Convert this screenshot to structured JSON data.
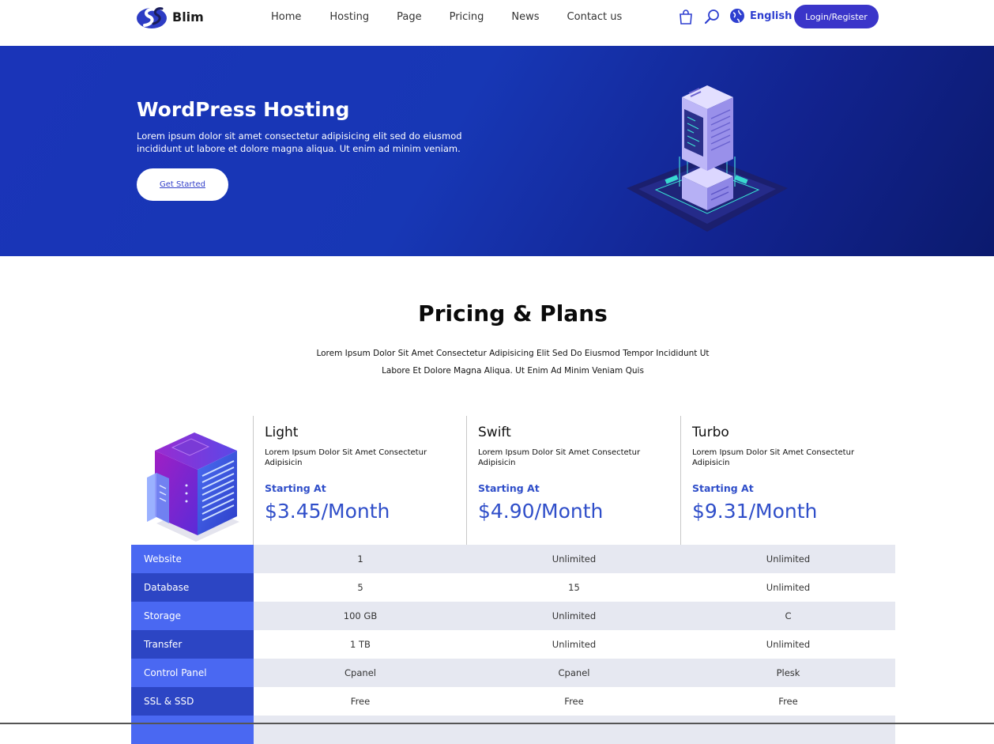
{
  "header": {
    "logo_text": "Blim",
    "nav": [
      "Home",
      "Hosting",
      "Page",
      "Pricing",
      "News",
      "Contact us"
    ],
    "language": "English",
    "login_label": "Login/Register"
  },
  "hero": {
    "title": "WordPress Hosting",
    "subtitle": "Lorem ipsum dolor sit amet consectetur adipisicing elit sed do eiusmod incididunt ut labore et dolore magna aliqua. Ut enim ad minim veniam.",
    "cta_label": "Get Started"
  },
  "pricing": {
    "title": "Pricing & Plans",
    "subtitle_line1": "Lorem Ipsum Dolor Sit Amet Consectetur Adipisicing Elit Sed Do Eiusmod Tempor Incididunt Ut",
    "subtitle_line2": "Labore Et Dolore Magna Aliqua. Ut Enim Ad Minim Veniam Quis",
    "plans": [
      {
        "name": "Light",
        "desc": "Lorem Ipsum Dolor Sit Amet Consectetur Adipisicin",
        "starting": "Starting At",
        "price": "$3.45/Month"
      },
      {
        "name": "Swift",
        "desc": "Lorem Ipsum Dolor Sit Amet Consectetur Adipisicin",
        "starting": "Starting At",
        "price": "$4.90/Month"
      },
      {
        "name": "Turbo",
        "desc": "Lorem Ipsum Dolor Sit Amet Consectetur Adipisicin",
        "starting": "Starting At",
        "price": "$9.31/Month"
      }
    ],
    "features": [
      {
        "label": "Website",
        "values": [
          "1",
          "Unlimited",
          "Unlimited"
        ]
      },
      {
        "label": "Database",
        "values": [
          "5",
          "15",
          "Unlimited"
        ]
      },
      {
        "label": "Storage",
        "values": [
          "100 GB",
          "Unlimited",
          "C"
        ]
      },
      {
        "label": "Transfer",
        "values": [
          "1 TB",
          "Unlimited",
          "Unlimited"
        ]
      },
      {
        "label": "Control Panel",
        "values": [
          "Cpanel",
          "Cpanel",
          "Plesk"
        ]
      },
      {
        "label": "SSL & SSD",
        "values": [
          "Free",
          "Free",
          "Free"
        ]
      },
      {
        "label": "",
        "values": [
          "",
          "",
          ""
        ]
      }
    ]
  },
  "colors": {
    "accent": "#2f4ec9",
    "hero_bg": "#1737b5",
    "label_dark": "#2c45c4",
    "label_light": "#4a68f2",
    "login_bg": "#3a35c9"
  }
}
